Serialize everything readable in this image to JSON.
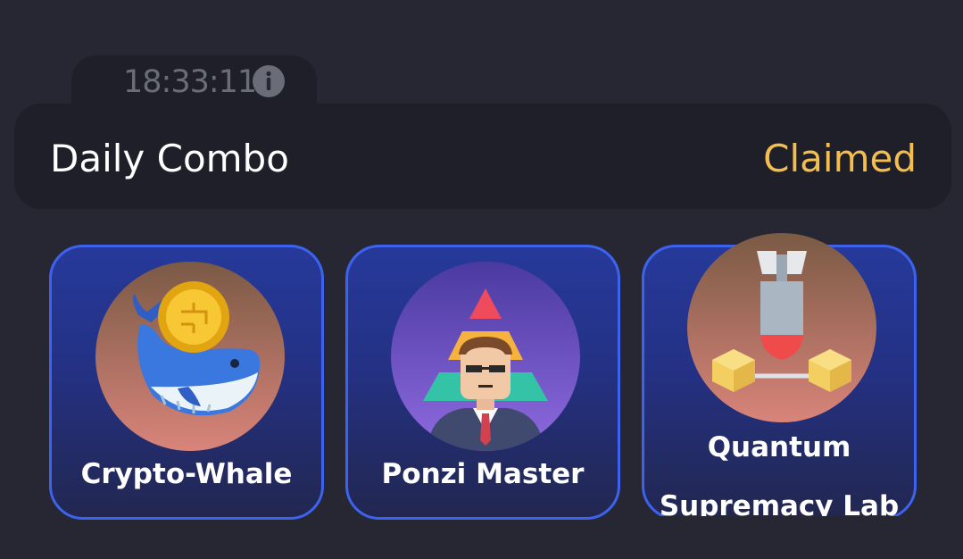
{
  "timer": {
    "value": "18:33:11",
    "icon": "info-icon"
  },
  "daily_combo": {
    "title": "Daily Combo",
    "status": "Claimed",
    "status_color": "#f3bd4f"
  },
  "cards": [
    {
      "label": "Crypto-Whale",
      "icon": "whale-with-coin-icon"
    },
    {
      "label": "Ponzi Master",
      "icon": "pyramid-businessman-icon"
    },
    {
      "label_line1": "Quantum",
      "label_line2": "Supremacy Lab",
      "icon": "bomb-cubes-icon"
    }
  ],
  "colors": {
    "background": "#262732",
    "panel": "#1e1f29",
    "card_border": "#3d63ee",
    "accent": "#f3bd4f"
  }
}
